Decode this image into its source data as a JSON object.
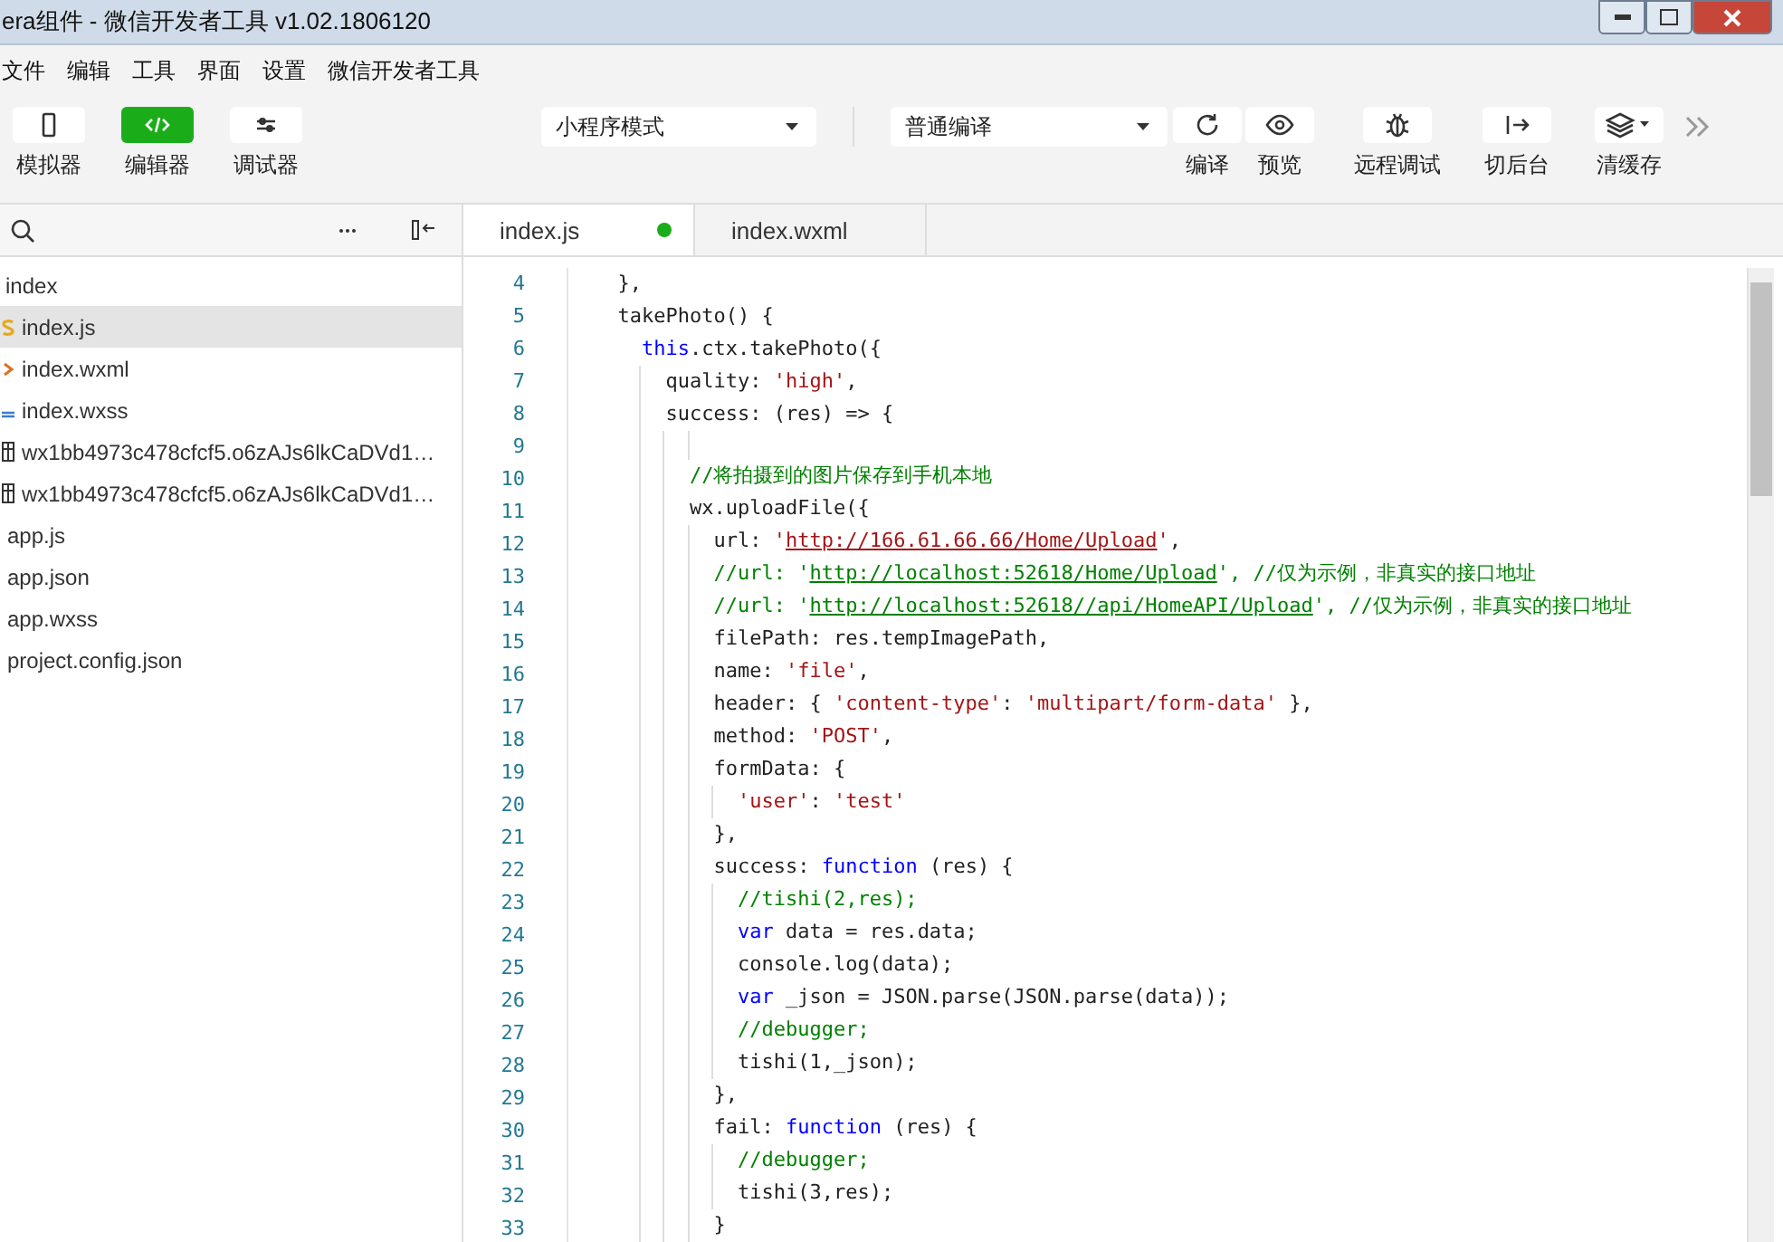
{
  "window": {
    "title": "era组件 - 微信开发者工具 v1.02.1806120"
  },
  "menu": [
    "文件",
    "编辑",
    "工具",
    "界面",
    "设置",
    "微信开发者工具"
  ],
  "view_toggles": [
    {
      "label": "模拟器",
      "selected": false,
      "kind": "phone"
    },
    {
      "label": "编辑器",
      "selected": true,
      "kind": "code"
    },
    {
      "label": "调试器",
      "selected": false,
      "kind": "sliders"
    }
  ],
  "mode_select": {
    "value": "小程序模式"
  },
  "compile_select": {
    "value": "普通编译"
  },
  "actions": [
    {
      "label": "编译",
      "kind": "refresh"
    },
    {
      "label": "预览",
      "kind": "eye"
    },
    {
      "label": "远程调试",
      "kind": "bug"
    },
    {
      "label": "切后台",
      "kind": "exit"
    },
    {
      "label": "清缓存",
      "kind": "layers"
    }
  ],
  "sidebar": {
    "items": [
      {
        "label": "index",
        "kind": "folder",
        "selected": false,
        "children": [
          {
            "label": "index.js",
            "kind": "js",
            "selected": true
          },
          {
            "label": "index.wxml",
            "kind": "wxml",
            "selected": false
          },
          {
            "label": "index.wxss",
            "kind": "wxss",
            "selected": false
          },
          {
            "label": "wx1bb4973c478cfcf5.o6zAJs6lkCaDVd1…",
            "kind": "file",
            "selected": false
          },
          {
            "label": "wx1bb4973c478cfcf5.o6zAJs6lkCaDVd1…",
            "kind": "file",
            "selected": false
          }
        ]
      },
      {
        "label": "app.js",
        "kind": "plain",
        "selected": false
      },
      {
        "label": "app.json",
        "kind": "plain",
        "selected": false
      },
      {
        "label": "app.wxss",
        "kind": "plain",
        "selected": false
      },
      {
        "label": "project.config.json",
        "kind": "plain",
        "selected": false
      }
    ]
  },
  "tabs": [
    {
      "label": "index.js",
      "selected": true,
      "modified": true
    },
    {
      "label": "index.wxml",
      "selected": false,
      "modified": false
    }
  ],
  "code": [
    {
      "n": "4",
      "tokens": [
        {
          "t": "  },",
          "kind": "plain"
        }
      ]
    },
    {
      "n": "5",
      "tokens": [
        {
          "t": "  takePhoto() {",
          "kind": "plain"
        }
      ]
    },
    {
      "n": "6",
      "tokens": [
        {
          "t": "    this",
          "kind": "kw"
        },
        {
          "t": ".ctx.takePhoto({",
          "kind": "plain"
        }
      ]
    },
    {
      "n": "7",
      "tokens": [
        {
          "t": "      quality: ",
          "kind": "plain"
        },
        {
          "t": "'high'",
          "kind": "str"
        },
        {
          "t": ",",
          "kind": "plain"
        }
      ]
    },
    {
      "n": "8",
      "tokens": [
        {
          "t": "      success: (res) => {",
          "kind": "plain"
        }
      ]
    },
    {
      "n": "9"
    },
    {
      "n": "10",
      "tokens": [
        {
          "t": "        //将拍摄到的图片保存到手机本地",
          "kind": "comment"
        }
      ]
    },
    {
      "n": "11",
      "tokens": [
        {
          "t": "        wx.uploadFile({",
          "kind": "plain"
        }
      ]
    },
    {
      "n": "12",
      "tokens": [
        {
          "t": "          url: ",
          "kind": "plain"
        },
        {
          "t": "'",
          "kind": "str"
        },
        {
          "t": "http://166.61.66.66/Home/Upload",
          "kind": "strlink"
        },
        {
          "t": "'",
          "kind": "str"
        },
        {
          "t": ",",
          "kind": "plain"
        }
      ]
    },
    {
      "n": "13",
      "tokens": [
        {
          "t": "          //url: '",
          "kind": "comment"
        },
        {
          "t": "http://localhost:52618/Home/Upload",
          "kind": "commentlink"
        },
        {
          "t": "', //仅为示例，非真实的接口地址",
          "kind": "comment"
        }
      ]
    },
    {
      "n": "14",
      "tokens": [
        {
          "t": "          //url: '",
          "kind": "comment"
        },
        {
          "t": "http://localhost:52618//api/HomeAPI/Upload",
          "kind": "commentlink"
        },
        {
          "t": "', //仅为示例，非真实的接口地址",
          "kind": "comment"
        }
      ]
    },
    {
      "n": "15",
      "tokens": [
        {
          "t": "          filePath: res.tempImagePath,",
          "kind": "plain"
        }
      ]
    },
    {
      "n": "16",
      "tokens": [
        {
          "t": "          name: ",
          "kind": "plain"
        },
        {
          "t": "'file'",
          "kind": "str"
        },
        {
          "t": ",",
          "kind": "plain"
        }
      ]
    },
    {
      "n": "17",
      "tokens": [
        {
          "t": "          header: { ",
          "kind": "plain"
        },
        {
          "t": "'content-type'",
          "kind": "str"
        },
        {
          "t": ": ",
          "kind": "plain"
        },
        {
          "t": "'multipart/form-data'",
          "kind": "str"
        },
        {
          "t": " },",
          "kind": "plain"
        }
      ]
    },
    {
      "n": "18",
      "tokens": [
        {
          "t": "          method: ",
          "kind": "plain"
        },
        {
          "t": "'POST'",
          "kind": "str"
        },
        {
          "t": ",",
          "kind": "plain"
        }
      ]
    },
    {
      "n": "19",
      "tokens": [
        {
          "t": "          formData: {",
          "kind": "plain"
        }
      ]
    },
    {
      "n": "20",
      "tokens": [
        {
          "t": "            'user'",
          "kind": "str"
        },
        {
          "t": ": ",
          "kind": "plain"
        },
        {
          "t": "'test'",
          "kind": "str"
        }
      ]
    },
    {
      "n": "21",
      "tokens": [
        {
          "t": "          },",
          "kind": "plain"
        }
      ]
    },
    {
      "n": "22",
      "tokens": [
        {
          "t": "          success: ",
          "kind": "plain"
        },
        {
          "t": "function",
          "kind": "kw"
        },
        {
          "t": " (res) {",
          "kind": "plain"
        }
      ]
    },
    {
      "n": "23",
      "tokens": [
        {
          "t": "            //tishi(2,res);",
          "kind": "comment"
        }
      ]
    },
    {
      "n": "24",
      "tokens": [
        {
          "t": "            var",
          "kind": "kw"
        },
        {
          "t": " data = res.data;",
          "kind": "plain"
        }
      ]
    },
    {
      "n": "25",
      "tokens": [
        {
          "t": "            console.log(data);",
          "kind": "plain"
        }
      ]
    },
    {
      "n": "26",
      "tokens": [
        {
          "t": "            var",
          "kind": "kw"
        },
        {
          "t": " _json = JSON.parse(JSON.parse(data));",
          "kind": "plain"
        }
      ]
    },
    {
      "n": "27",
      "tokens": [
        {
          "t": "            //debugger;",
          "kind": "comment"
        }
      ]
    },
    {
      "n": "28",
      "tokens": [
        {
          "t": "            tishi(1,_json);",
          "kind": "plain"
        }
      ]
    },
    {
      "n": "29",
      "tokens": [
        {
          "t": "          },",
          "kind": "plain"
        }
      ]
    },
    {
      "n": "30",
      "tokens": [
        {
          "t": "          fail: ",
          "kind": "plain"
        },
        {
          "t": "function",
          "kind": "kw"
        },
        {
          "t": " (res) {",
          "kind": "plain"
        }
      ]
    },
    {
      "n": "31",
      "tokens": [
        {
          "t": "            //debugger;",
          "kind": "comment"
        }
      ]
    },
    {
      "n": "32",
      "tokens": [
        {
          "t": "            tishi(3,res);",
          "kind": "plain"
        }
      ]
    },
    {
      "n": "33",
      "tokens": [
        {
          "t": "          }",
          "kind": "plain"
        }
      ]
    }
  ]
}
